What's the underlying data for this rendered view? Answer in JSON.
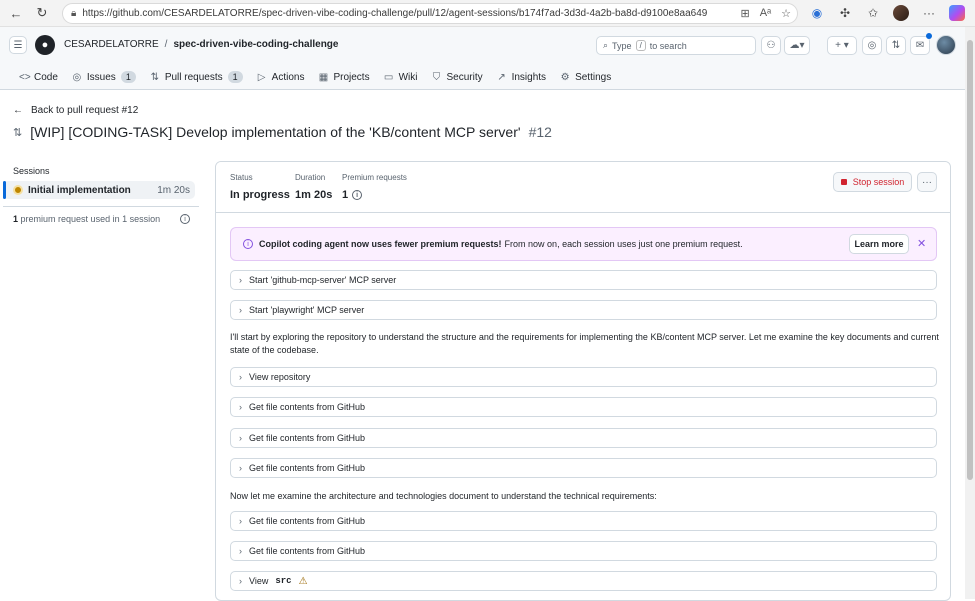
{
  "browser": {
    "url": "https://github.com/CESARDELATORRE/spec-driven-vibe-coding-challenge/pull/12/agent-sessions/b174f7ad-3d3d-4a2b-ba8d-d9100e8aa649"
  },
  "header": {
    "owner": "CESARDELATORRE",
    "separator": "/",
    "repo": "spec-driven-vibe-coding-challenge",
    "search_prefix": "Type",
    "search_key": "/",
    "search_suffix": "to search"
  },
  "nav": [
    {
      "label": "Code",
      "icon": "code-icon",
      "glyph": "<>"
    },
    {
      "label": "Issues",
      "icon": "issue-icon",
      "glyph": "◎",
      "count": "1"
    },
    {
      "label": "Pull requests",
      "icon": "pull-request-icon",
      "glyph": "⇅",
      "count": "1"
    },
    {
      "label": "Actions",
      "icon": "play-icon",
      "glyph": "▷"
    },
    {
      "label": "Projects",
      "icon": "table-icon",
      "glyph": "▦"
    },
    {
      "label": "Wiki",
      "icon": "book-icon",
      "glyph": "▭"
    },
    {
      "label": "Security",
      "icon": "shield-icon",
      "glyph": "⛉"
    },
    {
      "label": "Insights",
      "icon": "graph-icon",
      "glyph": "↗"
    },
    {
      "label": "Settings",
      "icon": "gear-icon",
      "glyph": "⚙"
    }
  ],
  "page": {
    "back_label": "Back to pull request #12",
    "title": "[WIP] [CODING-TASK] Develop implementation of the 'KB/content MCP server'",
    "number": "#12"
  },
  "sidebar": {
    "sessions_label": "Sessions",
    "session_name": "Initial implementation",
    "session_duration": "1m 20s",
    "premium_count": "1",
    "premium_text": "premium request used in 1 session"
  },
  "session": {
    "status_label": "Status",
    "status_value": "In progress",
    "duration_label": "Duration",
    "duration_value": "1m 20s",
    "premium_label": "Premium requests",
    "premium_value": "1",
    "stop_label": "Stop session",
    "more_label": "···"
  },
  "banner": {
    "bold": "Copilot coding agent now uses fewer premium requests!",
    "text": "From now on, each session uses just one premium request.",
    "learn_more": "Learn more",
    "close": "✕"
  },
  "log": {
    "step1": "Start 'github-mcp-server' MCP server",
    "step2": "Start 'playwright' MCP server",
    "para1": "I'll start by exploring the repository to understand the structure and the requirements for implementing the KB/content MCP server. Let me examine the key documents and current state of the codebase.",
    "step3": "View repository",
    "step4": "Get file contents from GitHub",
    "step5": "Get file contents from GitHub",
    "step6": "Get file contents from GitHub",
    "para2": "Now let me examine the architecture and technologies document to understand the technical requirements:",
    "step7": "Get file contents from GitHub",
    "step8": "Get file contents from GitHub",
    "step9_prefix": "View",
    "step9_code": "src"
  }
}
